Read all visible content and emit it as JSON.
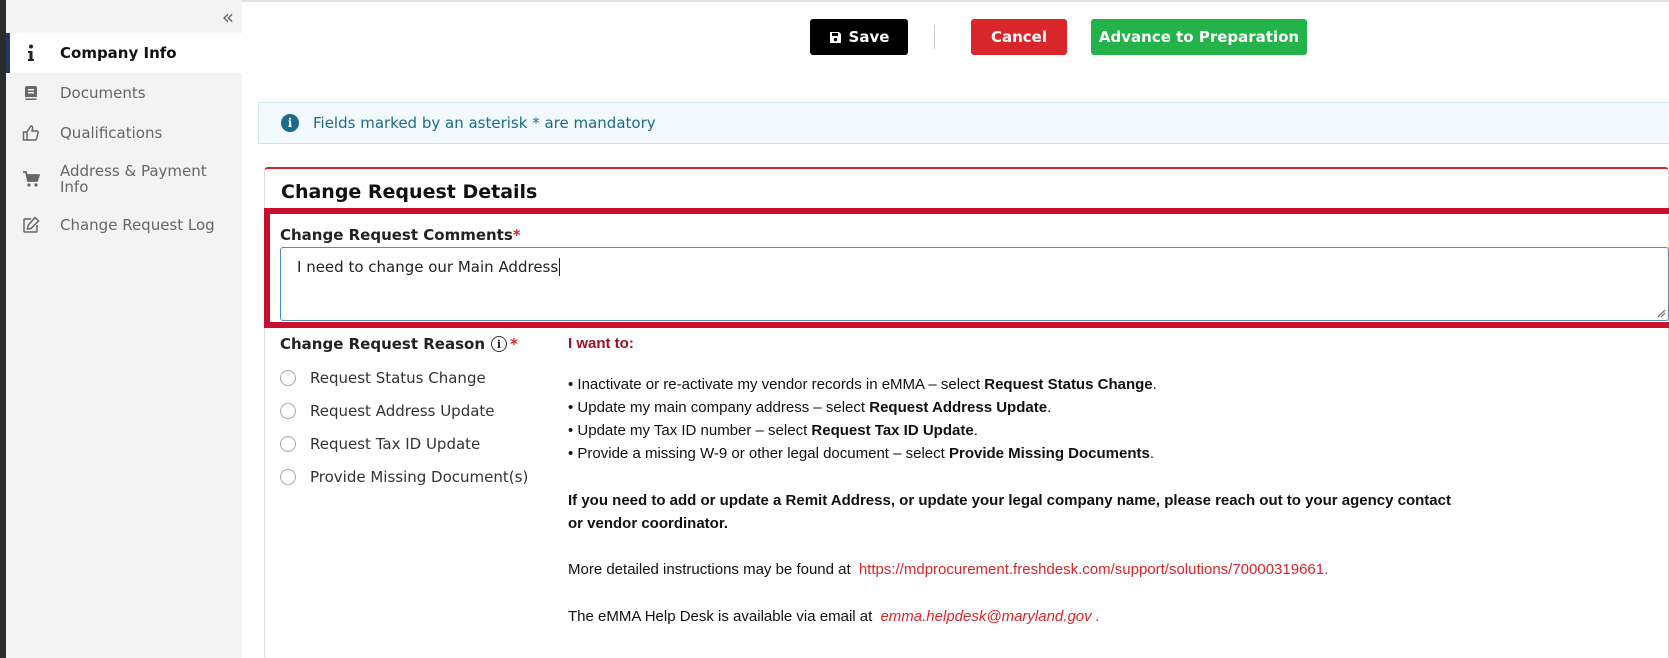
{
  "sidebar": {
    "collapse_glyph": "«",
    "items": [
      {
        "label": "Company Info",
        "icon": "info-icon",
        "active": true
      },
      {
        "label": "Documents",
        "icon": "book-icon"
      },
      {
        "label": "Qualifications",
        "icon": "thumbs-up-icon"
      },
      {
        "label": "Address & Payment Info",
        "icon": "cart-icon"
      },
      {
        "label": "Change Request Log",
        "icon": "edit-icon"
      }
    ]
  },
  "toolbar": {
    "save_label": "Save",
    "cancel_label": "Cancel",
    "advance_label": "Advance to Preparation"
  },
  "banner": {
    "text": "Fields marked by an asterisk * are mandatory"
  },
  "card": {
    "title": "Change Request Details",
    "comments_label": "Change Request Comments",
    "comments_value": "I need to change our Main Address",
    "required_mark": "*",
    "reason_label": "Change Request Reason",
    "reasons": [
      "Request Status Change",
      "Request Address Update",
      "Request Tax ID Update",
      "Provide Missing Document(s)"
    ]
  },
  "instructions": {
    "heading": "I want to:",
    "bullets": [
      {
        "prefix": "• Inactivate or re-activate my vendor records in eMMA – select ",
        "bold": "Request Status Change",
        "suffix": "."
      },
      {
        "prefix": "• Update my main company address – select ",
        "bold": "Request Address Update",
        "suffix": "."
      },
      {
        "prefix": "• Update my Tax ID number – select ",
        "bold": "Request Tax ID Update",
        "suffix": "."
      },
      {
        "prefix": "• Provide a missing W-9 or other legal document – select ",
        "bold": "Provide Missing Documents",
        "suffix": "."
      }
    ],
    "note": "If you need to add or update a Remit Address, or update your legal company name, please reach out to your agency contact or vendor coordinator.",
    "more_text": "More detailed instructions may be found at ",
    "more_link": "https://mdprocurement.freshdesk.com/support/solutions/70000319661.",
    "help_text": "The eMMA Help Desk is available via email at ",
    "help_email": "emma.helpdesk@maryland.gov ."
  },
  "colors": {
    "accent_red": "#d9262b",
    "advance_green": "#24b34b",
    "info_blue": "#1c6b8a",
    "highlight": "#c8102e"
  }
}
